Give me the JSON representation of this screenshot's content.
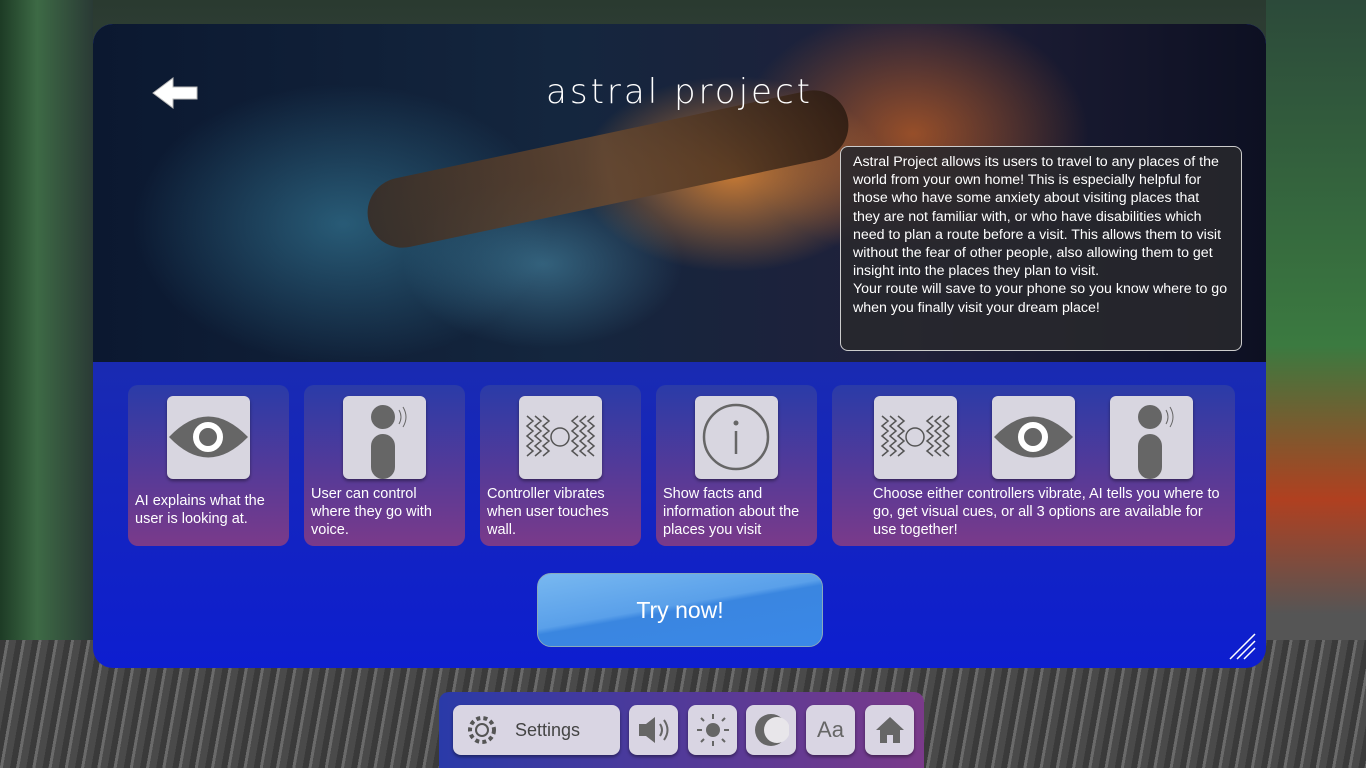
{
  "header": {
    "title": "astral project",
    "back_label": "back"
  },
  "description": {
    "paragraph1": "Astral Project allows its users to travel to any places of the world from your own home! This is especially helpful for those who have some anxiety about visiting places that they are not familiar with, or who have disabilities which need to plan a route before a visit. This allows them to visit without the fear of other people, also allowing them to get insight into the places they plan to visit.",
    "paragraph2": "Your route will save to your phone so you know where to go when you finally visit your dream place!"
  },
  "features": [
    {
      "icon": "eye-icon",
      "text": "AI explains what the user is looking at."
    },
    {
      "icon": "voice-user-icon",
      "text": "User can control where they go with voice."
    },
    {
      "icon": "vibration-icon",
      "text": "Controller vibrates when user touches wall."
    },
    {
      "icon": "info-icon",
      "text": "Show facts and information about the places you visit"
    },
    {
      "icons": [
        "vibration-icon",
        "eye-icon",
        "voice-user-icon"
      ],
      "text": "Choose either controllers vibrate, AI tells you where to go, get visual cues, or all 3 options are available for use together!"
    }
  ],
  "cta": {
    "label": "Try now!"
  },
  "toolbar": {
    "settings_label": "Settings",
    "text_size_label": "Aa",
    "icons": [
      "gear-icon",
      "volume-icon",
      "brightness-icon",
      "dark-mode-icon",
      "text-size-icon",
      "home-icon"
    ]
  },
  "colors": {
    "panel": "#1a2bb0",
    "card_top": "#2a3ba8",
    "card_bottom": "#7a3a8a",
    "button": "#4a94e8"
  }
}
